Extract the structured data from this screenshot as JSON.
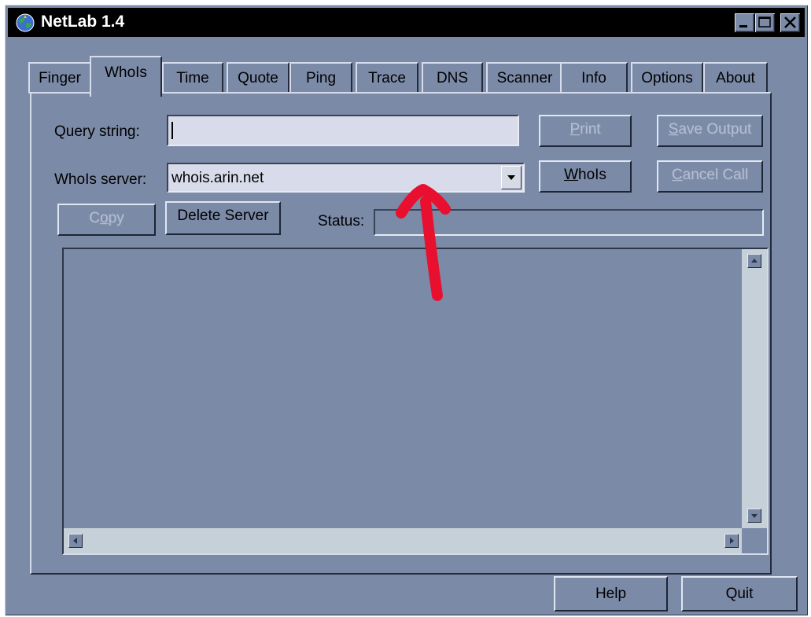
{
  "window": {
    "title": "NetLab 1.4",
    "icon": "netlab-app-icon",
    "controls": [
      "minimize-icon",
      "maximize-icon",
      "close-icon"
    ]
  },
  "tabs": [
    {
      "label": "Finger",
      "active": false
    },
    {
      "label": "WhoIs",
      "active": true
    },
    {
      "label": "Time",
      "active": false
    },
    {
      "label": "Quote",
      "active": false
    },
    {
      "label": "Ping",
      "active": false
    },
    {
      "label": "Trace",
      "active": false
    },
    {
      "label": "DNS",
      "active": false
    },
    {
      "label": "Scanner",
      "active": false
    },
    {
      "label": "Info",
      "active": false
    },
    {
      "label": "Options",
      "active": false
    },
    {
      "label": "About",
      "active": false
    }
  ],
  "form": {
    "query_label": "Query string:",
    "query_value": "",
    "server_label": "WhoIs server:",
    "server_value": "whois.arin.net",
    "status_label": "Status:",
    "status_value": ""
  },
  "buttons": {
    "print": {
      "label": "Print",
      "mnemonic": "P",
      "enabled": false
    },
    "save_output": {
      "label": "Save Output",
      "mnemonic": "S",
      "enabled": false
    },
    "whois": {
      "label": "WhoIs",
      "mnemonic": "W",
      "enabled": true
    },
    "cancel_call": {
      "label": "Cancel Call",
      "mnemonic": "C",
      "enabled": false
    },
    "copy": {
      "label": "Copy",
      "mnemonic": "o",
      "enabled": false
    },
    "delete_server": {
      "label": "Delete Server",
      "enabled": true
    },
    "help": {
      "label": "Help",
      "enabled": true
    },
    "quit": {
      "label": "Quit",
      "enabled": true
    }
  },
  "annotation": {
    "color": "#e8102e",
    "shape": "arrow-up"
  },
  "colors": {
    "window_bg": "#7b8aa7",
    "field_bg": "#d8dcea",
    "title_bg": "#000000"
  }
}
